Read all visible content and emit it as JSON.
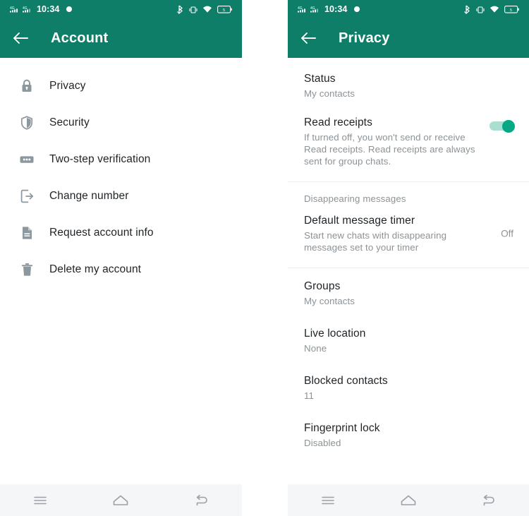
{
  "statusbar": {
    "time": "10:34",
    "signal_label": "4G",
    "icons": [
      "signal-4g-icon",
      "signal-4g-icon",
      "record-dot-icon",
      "bluetooth-icon",
      "vibrate-icon",
      "wifi-icon",
      "battery-icon"
    ],
    "battery_label": "5"
  },
  "theme": {
    "header_green": "#0e7e68",
    "toggle_on": "#05a884",
    "toggle_track": "#a9ded0",
    "text_primary": "#1f2326",
    "text_secondary": "#8c9296",
    "divider": "#eceef0",
    "navbar_bg": "#f5f6f7"
  },
  "left_screen": {
    "title": "Account",
    "back_label": "Back",
    "items": [
      {
        "label": "Privacy",
        "icon": "lock-icon"
      },
      {
        "label": "Security",
        "icon": "shield-icon"
      },
      {
        "label": "Two-step verification",
        "icon": "two-step-dots-icon"
      },
      {
        "label": "Change number",
        "icon": "change-number-icon"
      },
      {
        "label": "Request account info",
        "icon": "document-icon"
      },
      {
        "label": "Delete my account",
        "icon": "trash-icon"
      }
    ]
  },
  "right_screen": {
    "title": "Privacy",
    "back_label": "Back",
    "section_header": "Disappearing messages",
    "items": [
      {
        "title": "Status",
        "sub": "My contacts",
        "value": "",
        "toggle": null
      },
      {
        "title": "Read receipts",
        "sub": "If turned off, you won't send or receive Read receipts. Read receipts are always sent for group chats.",
        "value": "",
        "toggle": "on"
      },
      {
        "title": "Default message timer",
        "sub": "Start new chats with disappearing messages set to your timer",
        "value": "Off",
        "toggle": null
      },
      {
        "title": "Groups",
        "sub": "My contacts",
        "value": "",
        "toggle": null
      },
      {
        "title": "Live location",
        "sub": "None",
        "value": "",
        "toggle": null
      },
      {
        "title": "Blocked contacts",
        "sub": "11",
        "value": "",
        "toggle": null
      },
      {
        "title": "Fingerprint lock",
        "sub": "Disabled",
        "value": "",
        "toggle": null
      }
    ]
  },
  "navbar": {
    "recents_label": "Recents",
    "home_label": "Home",
    "back_label": "Back"
  }
}
